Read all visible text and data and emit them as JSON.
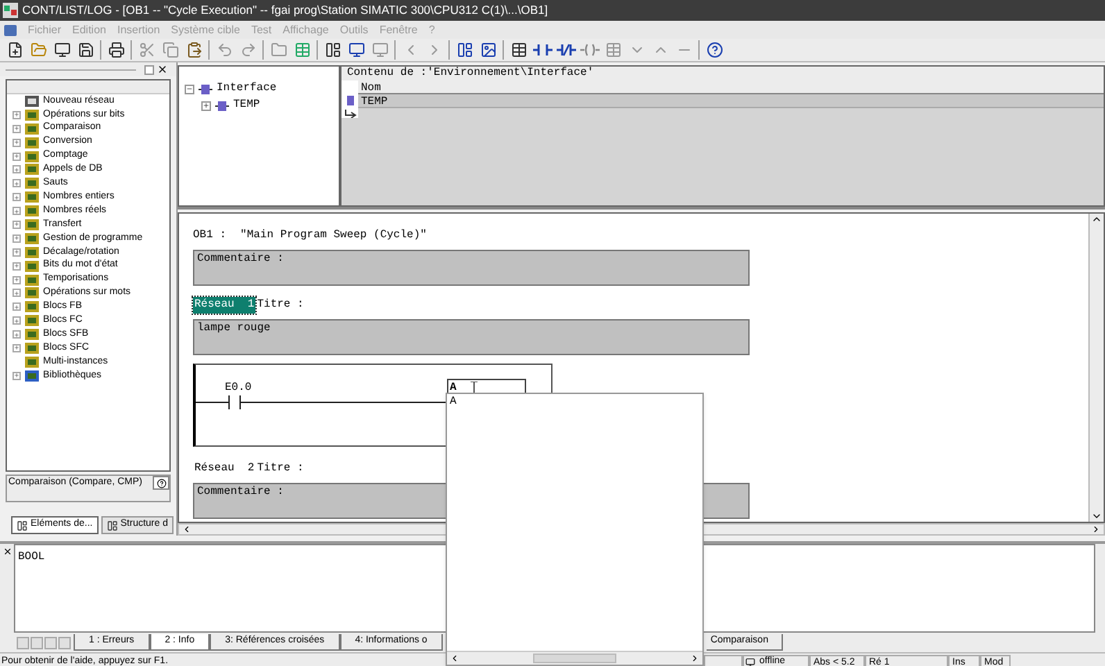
{
  "window": {
    "title": "CONT/LIST/LOG - [OB1 -- \"Cycle Execution\" -- fgai prog\\Station SIMATIC 300\\CPU312 C(1)\\...\\OB1]"
  },
  "menu": [
    {
      "label": "Fichier",
      "disabled": true
    },
    {
      "label": "Edition",
      "disabled": true
    },
    {
      "label": "Insertion",
      "disabled": true
    },
    {
      "label": "Système cible",
      "disabled": true
    },
    {
      "label": "Test",
      "disabled": true
    },
    {
      "label": "Affichage",
      "disabled": true
    },
    {
      "label": "Outils",
      "disabled": true
    },
    {
      "label": "Fenêtre",
      "disabled": true
    },
    {
      "label": "?",
      "disabled": true
    }
  ],
  "elements_panel": {
    "items": [
      {
        "label": "Nouveau réseau",
        "expandable": false
      },
      {
        "label": "Opérations sur bits",
        "expandable": true
      },
      {
        "label": "Comparaison",
        "expandable": true
      },
      {
        "label": "Conversion",
        "expandable": true
      },
      {
        "label": "Comptage",
        "expandable": true
      },
      {
        "label": "Appels de DB",
        "expandable": true
      },
      {
        "label": "Sauts",
        "expandable": true
      },
      {
        "label": "Nombres entiers",
        "expandable": true
      },
      {
        "label": "Nombres réels",
        "expandable": true
      },
      {
        "label": "Transfert",
        "expandable": true
      },
      {
        "label": "Gestion de programme",
        "expandable": true
      },
      {
        "label": "Décalage/rotation",
        "expandable": true
      },
      {
        "label": "Bits du mot d'état",
        "expandable": true
      },
      {
        "label": "Temporisations",
        "expandable": true
      },
      {
        "label": "Opérations sur mots",
        "expandable": true
      },
      {
        "label": "Blocs FB",
        "expandable": true
      },
      {
        "label": "Blocs FC",
        "expandable": true
      },
      {
        "label": "Blocs SFB",
        "expandable": true
      },
      {
        "label": "Blocs SFC",
        "expandable": true
      },
      {
        "label": "Multi-instances",
        "expandable": false
      },
      {
        "label": "Bibliothèques",
        "expandable": true
      }
    ],
    "description": "Comparaison (Compare, CMP)",
    "tabs": [
      {
        "label": "Eléments de...",
        "selected": true
      },
      {
        "label": "Structure d",
        "selected": false
      }
    ]
  },
  "interface": {
    "tree": {
      "label": "Interface",
      "expanded": true,
      "children": [
        {
          "label": "TEMP",
          "expanded": false
        }
      ]
    },
    "table_title": "Contenu de :'Environnement\\Interface'",
    "columns": [
      "Nom"
    ],
    "rows": [
      "TEMP"
    ]
  },
  "editor": {
    "block": "OB1 :",
    "block_title": "\"Main Program Sweep (Cycle)\"",
    "comment": "Commentaire :",
    "networks": [
      {
        "label": "Réseau",
        "number": "1",
        "title": "Titre :",
        "selected": true,
        "comment": "lampe rouge",
        "ladder": {
          "contact": "E0.0",
          "coil_input": "A"
        }
      },
      {
        "label": "Réseau",
        "number": "2",
        "title": "Titre :",
        "selected": false,
        "comment": "Commentaire :"
      }
    ],
    "dropdown": {
      "items": [
        "A"
      ]
    }
  },
  "output": {
    "text": "BOOL",
    "tabs": [
      {
        "label": "1 : Erreurs",
        "selected": false
      },
      {
        "label": "2 : Info",
        "selected": true
      },
      {
        "label": "3: Références croisées",
        "selected": false
      },
      {
        "label": "4: Informations o",
        "selected": false
      },
      {
        "label": "Comparaison",
        "selected": false
      }
    ]
  },
  "status_bar": {
    "help": "Pour obtenir de l'aide, appuyez sur F1.",
    "mode": "offline",
    "address": "Abs < 5.2",
    "network": "Ré 1",
    "insert": "Ins",
    "modified": "Mod"
  }
}
